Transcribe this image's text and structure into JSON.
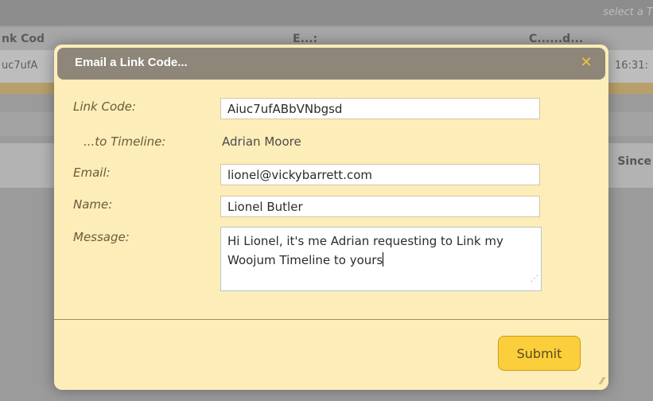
{
  "background": {
    "hint_text": "select a T",
    "headers": [
      "nk Cod",
      "E...:",
      "C......d..."
    ],
    "cells": [
      "uc7ufA",
      "16:31:"
    ],
    "since_label": "Since"
  },
  "modal": {
    "title": "Email a Link Code...",
    "close_glyph": "✕",
    "fields": {
      "link_code": {
        "label": "Link Code:",
        "value": "Aiuc7ufABbVNbgsd"
      },
      "timeline": {
        "label": "...to Timeline:",
        "value": "Adrian Moore"
      },
      "email": {
        "label": "Email:",
        "value": "lionel@vickybarrett.com"
      },
      "name": {
        "label": "Name:",
        "value": "Lionel Butler"
      },
      "message": {
        "label": "Message:",
        "value": "Hi Lionel, it's me Adrian requesting to Link my Woojum Timeline to yours"
      }
    },
    "submit_label": "Submit"
  },
  "icons": {
    "close": "close-icon",
    "resize": "resize-grip-icon"
  }
}
